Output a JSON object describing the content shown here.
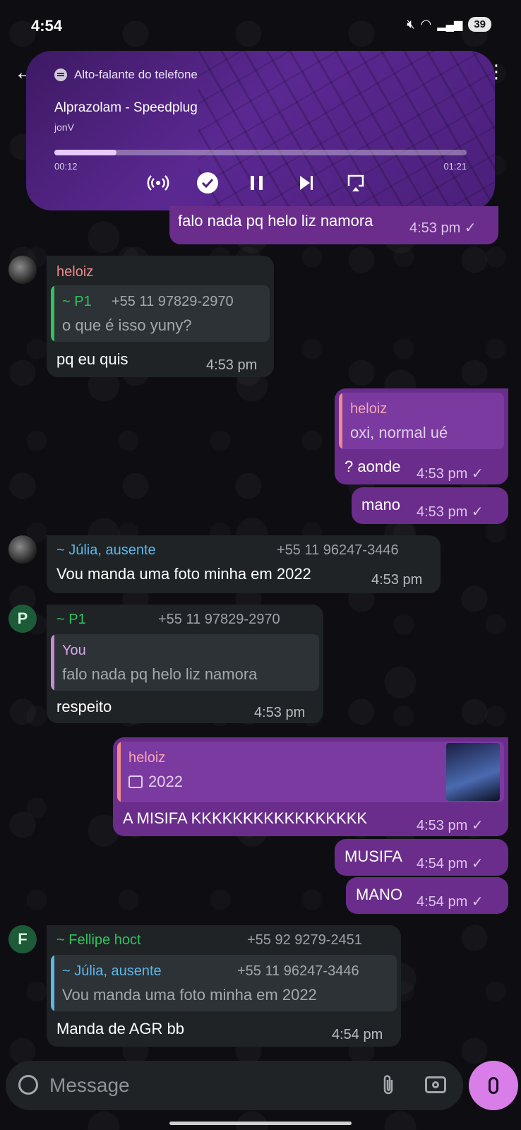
{
  "status_bar": {
    "time": "4:54",
    "battery": "39"
  },
  "media": {
    "output": "Alto-falante do telefone",
    "title": "Alprazolam - Speedplug",
    "artist": "jonV",
    "elapsed": "00:12",
    "duration": "01:21",
    "progress": 0.15
  },
  "messages": {
    "m1": {
      "text": "falo nada pq helo liz namora",
      "time": "4:53 pm"
    },
    "m2": {
      "sender": "heloiz",
      "quote_name": "~ P1",
      "quote_phone": "+55 11 97829-2970",
      "quote_text": "o que é isso yuny?",
      "text": "pq eu quis",
      "time": "4:53 pm"
    },
    "m3": {
      "quote_name": "heloiz",
      "quote_text": "oxi, normal ué",
      "text": "? aonde",
      "time": "4:53 pm"
    },
    "m4": {
      "text": "mano",
      "time": "4:53 pm"
    },
    "m5": {
      "sender": "~ Júlia, ausente",
      "phone": "+55 11 96247-3446",
      "text": "Vou manda uma foto minha em 2022",
      "time": "4:53 pm"
    },
    "m6": {
      "avatar": "P",
      "sender": "~ P1",
      "phone": "+55 11 97829-2970",
      "quote_name": "You",
      "quote_text": "falo nada pq helo liz namora",
      "text": "respeito",
      "time": "4:53 pm"
    },
    "m7": {
      "quote_name": "heloiz",
      "quote_text": "2022",
      "text": "A MISIFA KKKKKKKKKKKKKKKKK",
      "time": "4:53 pm"
    },
    "m8": {
      "text": "MUSIFA",
      "time": "4:54 pm"
    },
    "m9": {
      "text": "MANO",
      "time": "4:54 pm"
    },
    "m10": {
      "avatar": "F",
      "sender": "~ Fellipe hoct",
      "phone": "+55 92 9279-2451",
      "quote_name": "~ Júlia, ausente",
      "quote_phone": "+55 11 96247-3446",
      "quote_text": "Vou manda uma foto minha em 2022",
      "text": "Manda de AGR bb",
      "time": "4:54 pm"
    }
  },
  "composer": {
    "placeholder": "Message"
  },
  "colors": {
    "outgoing": "#6a2d8c",
    "incoming": "#1f2326",
    "accent": "#d97ee8"
  }
}
